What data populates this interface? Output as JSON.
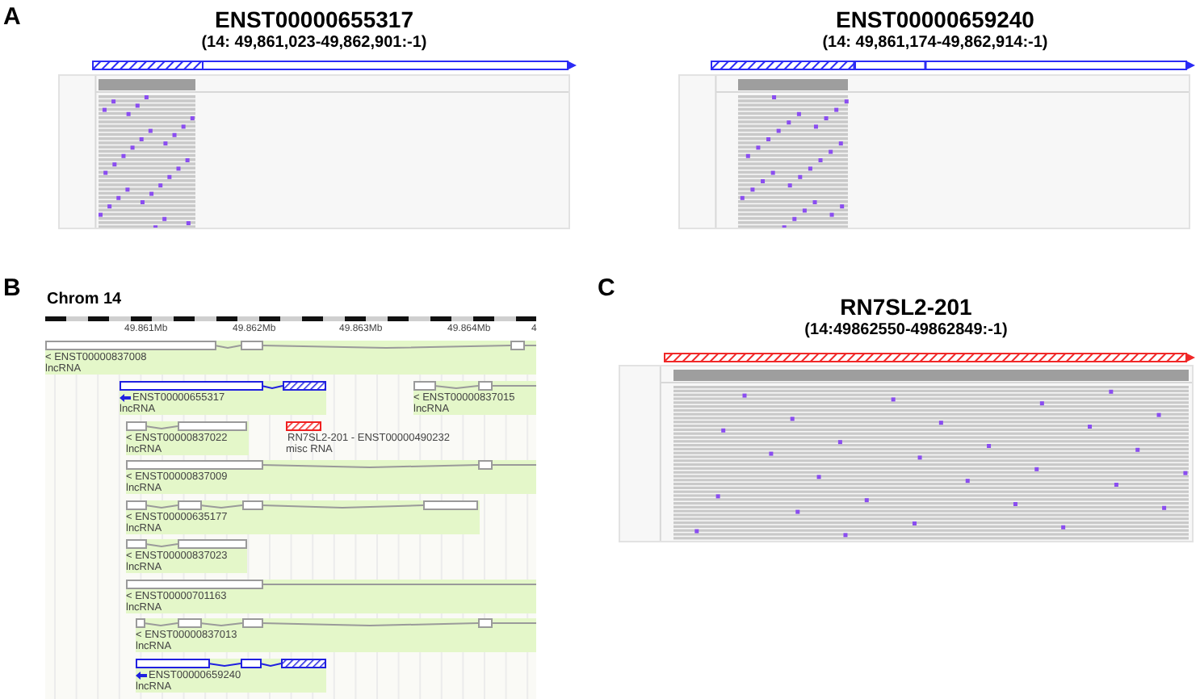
{
  "panel_a": {
    "letter": "A",
    "views": [
      {
        "title": "ENST00000655317",
        "locus": "(14: 49,861,023-49,862,901:-1)"
      },
      {
        "title": "ENST00000659240",
        "locus": "(14: 49,861,174-49,862,914:-1)"
      }
    ]
  },
  "panel_b": {
    "letter": "B",
    "title": "Chrom 14",
    "ruler_labels": [
      "49.861Mb",
      "49.862Mb",
      "49.863Mb",
      "49.864Mb",
      "4"
    ],
    "features": [
      {
        "kind": "grey",
        "label": "< ENST00000837008",
        "biotype": "lncRNA"
      },
      {
        "kind": "blue",
        "label": "ENST00000655317",
        "biotype": "lncRNA"
      },
      {
        "kind": "grey",
        "label": "< ENST00000837015",
        "biotype": "lncRNA"
      },
      {
        "kind": "grey",
        "label": "< ENST00000837022",
        "biotype": "lncRNA"
      },
      {
        "kind": "red",
        "label": "RN7SL2-201 - ENST00000490232",
        "biotype": "misc RNA"
      },
      {
        "kind": "grey",
        "label": "< ENST00000837009",
        "biotype": "lncRNA"
      },
      {
        "kind": "grey",
        "label": "< ENST00000635177",
        "biotype": "lncRNA"
      },
      {
        "kind": "grey",
        "label": "< ENST00000837023",
        "biotype": "lncRNA"
      },
      {
        "kind": "grey",
        "label": "< ENST00000701163",
        "biotype": "lncRNA"
      },
      {
        "kind": "grey",
        "label": "< ENST00000837013",
        "biotype": "lncRNA"
      },
      {
        "kind": "blue",
        "label": "ENST00000659240",
        "biotype": "lncRNA"
      }
    ]
  },
  "panel_c": {
    "letter": "C",
    "title": "RN7SL2-201",
    "locus": "(14:49862550-49862849:-1)"
  }
}
